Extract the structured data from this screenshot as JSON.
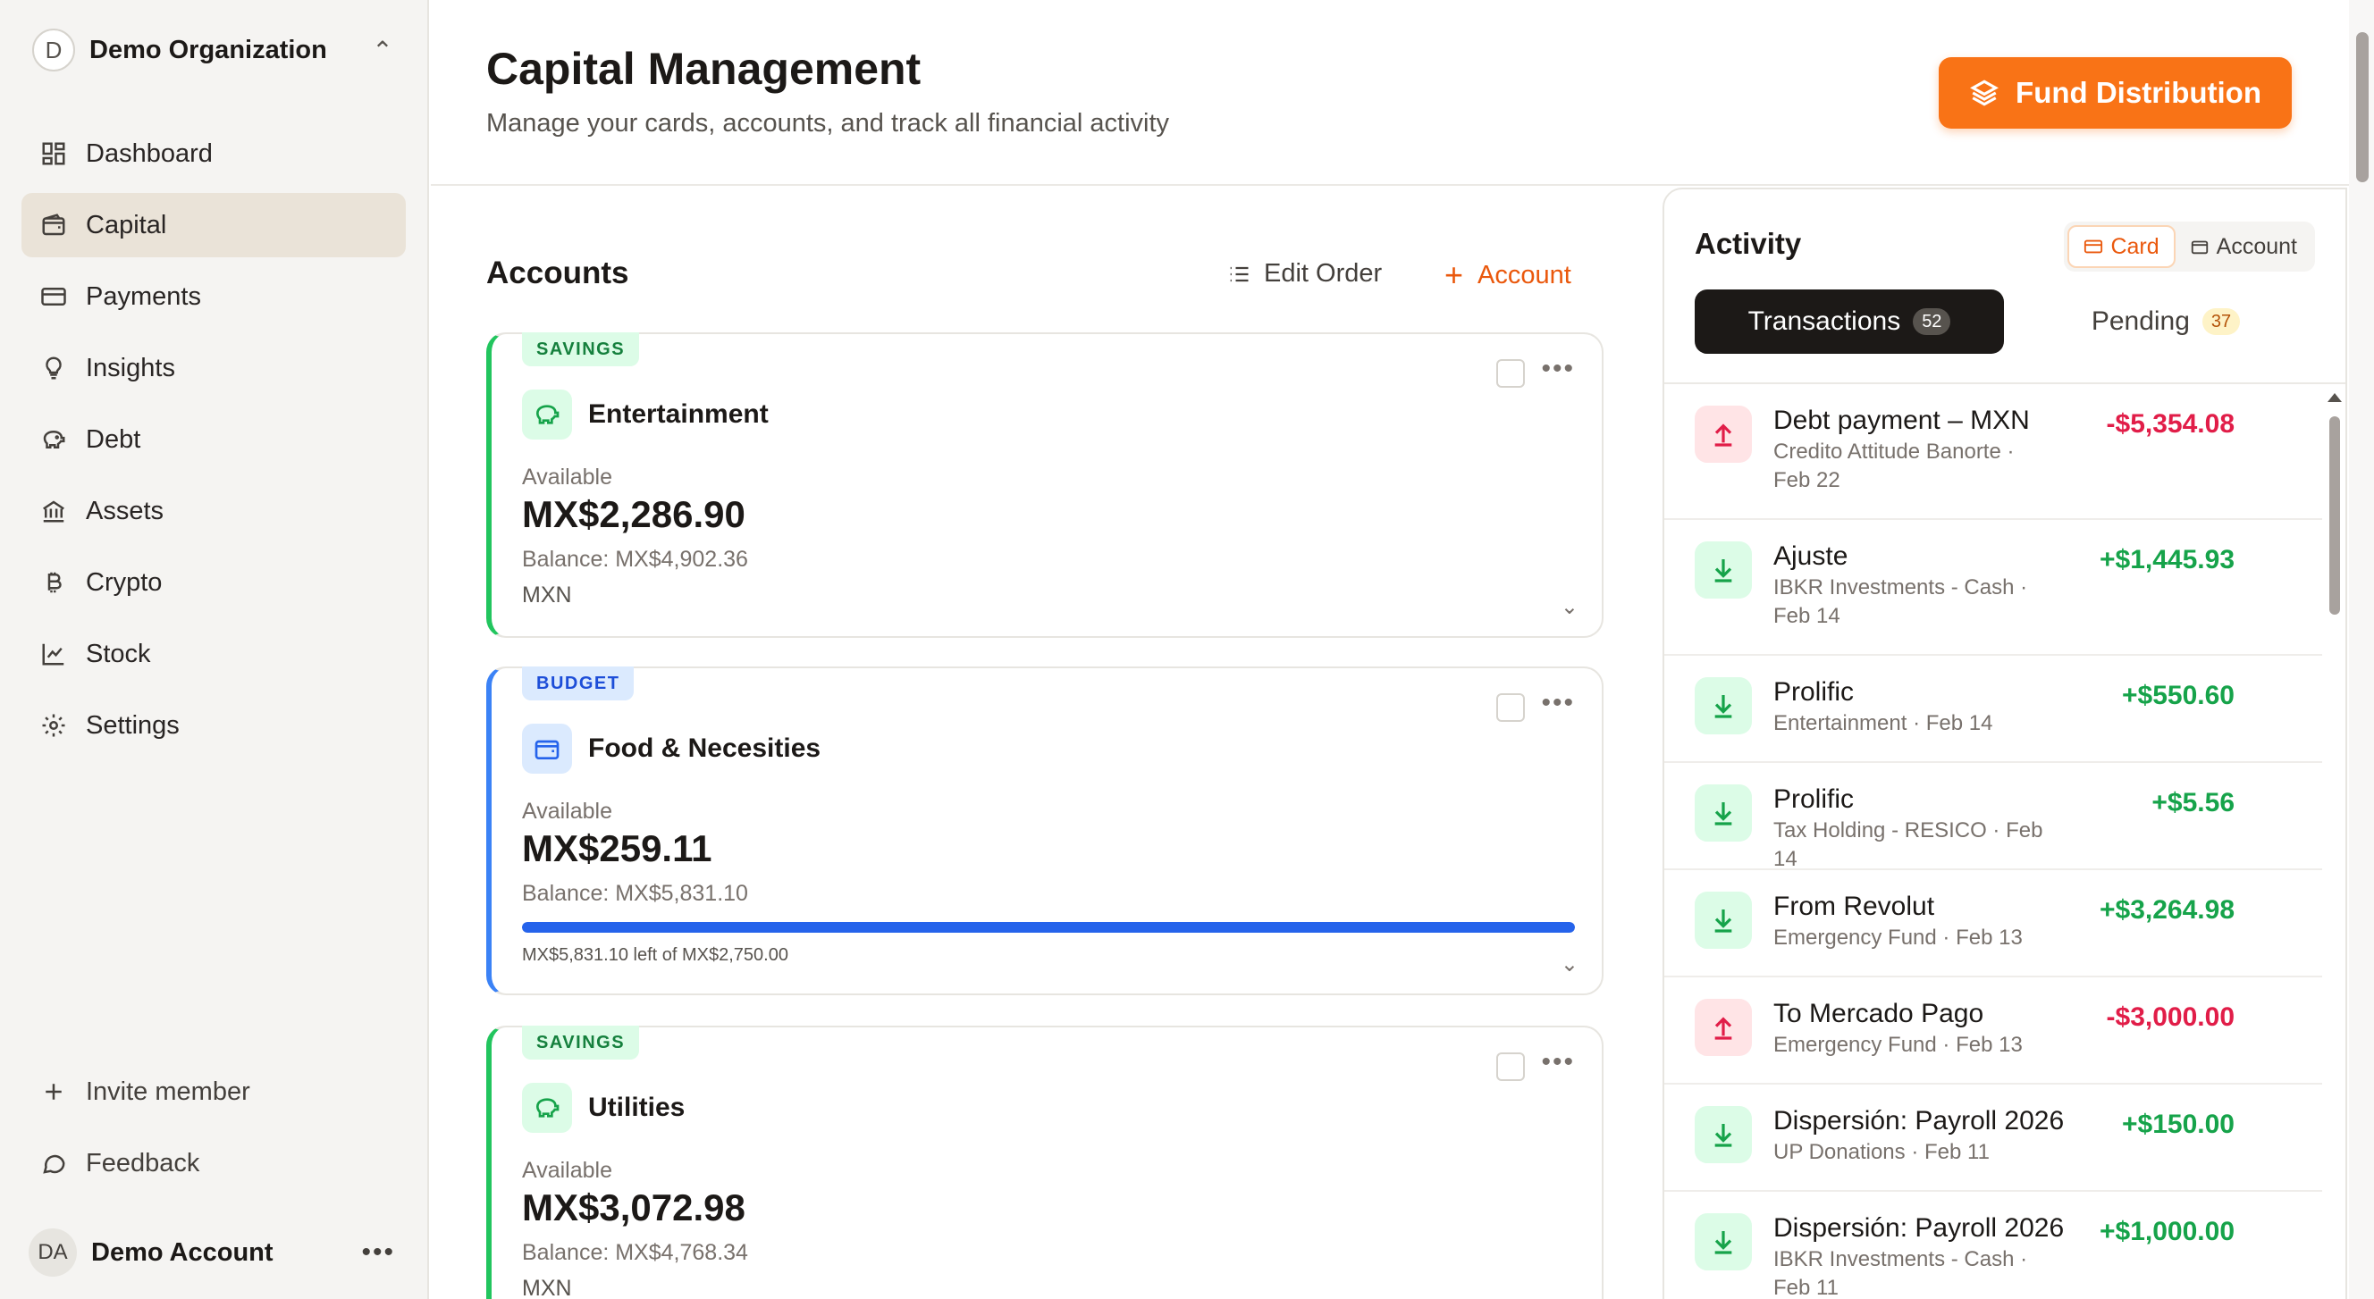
{
  "org": {
    "avatar": "D",
    "name": "Demo Organization",
    "toggle_icon": "chevrons-up-down-icon"
  },
  "nav": [
    {
      "label": "Dashboard",
      "icon": "dashboard-icon"
    },
    {
      "label": "Capital",
      "icon": "wallet-icon",
      "active": true
    },
    {
      "label": "Payments",
      "icon": "credit-card-icon"
    },
    {
      "label": "Insights",
      "icon": "lightbulb-icon"
    },
    {
      "label": "Debt",
      "icon": "piggy-bank-icon"
    },
    {
      "label": "Assets",
      "icon": "bank-icon"
    },
    {
      "label": "Crypto",
      "icon": "bitcoin-icon"
    },
    {
      "label": "Stock",
      "icon": "line-chart-icon"
    },
    {
      "label": "Settings",
      "icon": "gear-icon"
    }
  ],
  "sidebar_bottom": {
    "invite": "Invite member",
    "feedback": "Feedback"
  },
  "account": {
    "avatar": "DA",
    "name": "Demo Account"
  },
  "header": {
    "title": "Capital Management",
    "subtitle": "Manage your cards, accounts, and track all financial activity",
    "fund_button": "Fund Distribution"
  },
  "accounts": {
    "title": "Accounts",
    "edit_order": "Edit Order",
    "add_account": "Account",
    "cards": [
      {
        "tag": "SAVINGS",
        "name": "Entertainment",
        "available_label": "Available",
        "amount": "MX$2,286.90",
        "balance": "Balance: MX$4,902.36",
        "currency": "MXN"
      },
      {
        "tag": "BUDGET",
        "name": "Food & Necesities",
        "available_label": "Available",
        "amount": "MX$259.11",
        "balance": "Balance: MX$5,831.10",
        "progress": 1.0,
        "progress_text": "MX$5,831.10 left of MX$2,750.00"
      },
      {
        "tag": "SAVINGS",
        "name": "Utilities",
        "available_label": "Available",
        "amount": "MX$3,072.98",
        "balance": "Balance: MX$4,768.34",
        "currency": "MXN"
      }
    ]
  },
  "activity": {
    "title": "Activity",
    "toggle": {
      "card": "Card",
      "account": "Account"
    },
    "tabs": {
      "transactions": "Transactions",
      "transactions_count": "52",
      "pending": "Pending",
      "pending_count": "37"
    },
    "transactions": [
      {
        "name": "Debt payment – MXN",
        "sub1": "Credito Attitude Banorte ·",
        "sub2": "Feb 22",
        "amount": "-$5,354.08",
        "direction": "out"
      },
      {
        "name": "Ajuste",
        "sub1": "IBKR Investments - Cash ·",
        "sub2": "Feb 14",
        "amount": "+$1,445.93",
        "direction": "in"
      },
      {
        "name": "Prolific",
        "sub1": "Entertainment · Feb 14",
        "sub2": "",
        "amount": "+$550.60",
        "direction": "in"
      },
      {
        "name": "Prolific",
        "sub1": "Tax Holding - RESICO · Feb 14",
        "sub2": "",
        "amount": "+$5.56",
        "direction": "in"
      },
      {
        "name": "From Revolut",
        "sub1": "Emergency Fund · Feb 13",
        "sub2": "",
        "amount": "+$3,264.98",
        "direction": "in"
      },
      {
        "name": "To Mercado Pago",
        "sub1": "Emergency Fund · Feb 13",
        "sub2": "",
        "amount": "-$3,000.00",
        "direction": "out"
      },
      {
        "name": "Dispersión: Payroll 2026",
        "sub1": "UP Donations · Feb 11",
        "sub2": "",
        "amount": "+$150.00",
        "direction": "in"
      },
      {
        "name": "Dispersión: Payroll 2026",
        "sub1": "IBKR Investments - Cash ·",
        "sub2": "Feb 11",
        "amount": "+$1,000.00",
        "direction": "in"
      }
    ]
  },
  "colors": {
    "accent": "#f97316",
    "positive": "#16a34a",
    "negative": "#e11d48",
    "budget": "#2563eb"
  }
}
